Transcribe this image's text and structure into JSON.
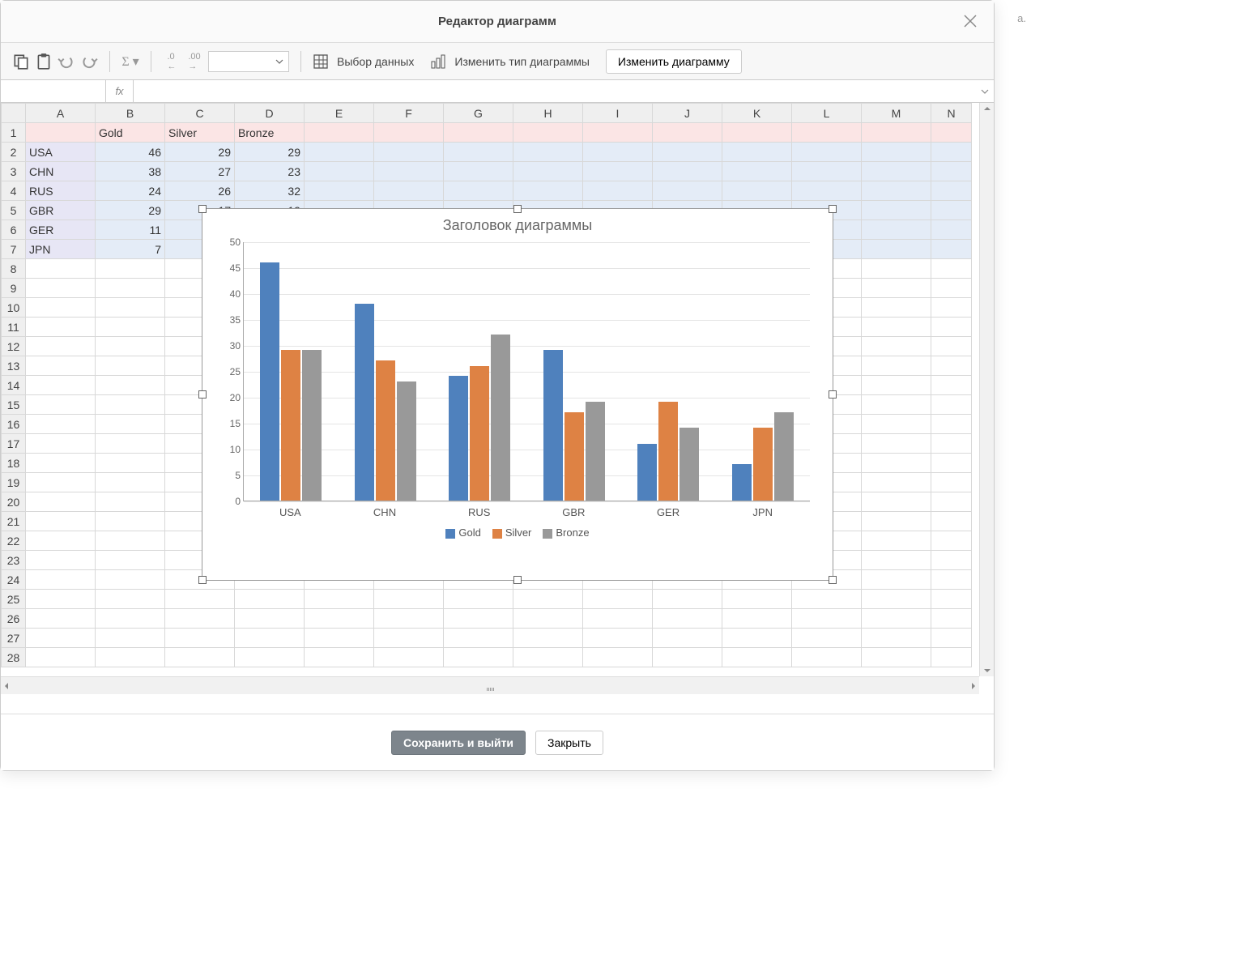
{
  "window": {
    "title": "Редактор диаграмм"
  },
  "toolbar": {
    "select_data": "Выбор данных",
    "change_type": "Изменить тип диаграммы",
    "edit_chart": "Изменить диаграмму"
  },
  "formula_bar": {
    "fx": "fx"
  },
  "columns": [
    "A",
    "B",
    "C",
    "D",
    "E",
    "F",
    "G",
    "H",
    "I",
    "J",
    "K",
    "L",
    "M",
    "N"
  ],
  "row_numbers": [
    1,
    2,
    3,
    4,
    5,
    6,
    7,
    8,
    9,
    10,
    11,
    12,
    13,
    14,
    15,
    16,
    17,
    18,
    19,
    20,
    21,
    22,
    23,
    24,
    25,
    26,
    27,
    28
  ],
  "sheet": {
    "header_row": [
      "",
      "Gold",
      "Silver",
      "Bronze"
    ],
    "data_rows": [
      [
        "USA",
        46,
        29,
        29
      ],
      [
        "CHN",
        38,
        27,
        23
      ],
      [
        "RUS",
        24,
        26,
        32
      ],
      [
        "GBR",
        29,
        17,
        19
      ],
      [
        "GER",
        11,
        "",
        ""
      ],
      [
        "JPN",
        7,
        "",
        ""
      ]
    ]
  },
  "chart_data": {
    "type": "bar",
    "title": "Заголовок диаграммы",
    "categories": [
      "USA",
      "CHN",
      "RUS",
      "GBR",
      "GER",
      "JPN"
    ],
    "series": [
      {
        "name": "Gold",
        "color": "#4f81bd",
        "values": [
          46,
          38,
          24,
          29,
          11,
          7
        ]
      },
      {
        "name": "Silver",
        "color": "#de8244",
        "values": [
          29,
          27,
          26,
          17,
          19,
          14
        ]
      },
      {
        "name": "Bronze",
        "color": "#999999",
        "values": [
          29,
          23,
          32,
          19,
          14,
          17
        ]
      }
    ],
    "ylim": [
      0,
      50
    ],
    "y_ticks": [
      0,
      5,
      10,
      15,
      20,
      25,
      30,
      35,
      40,
      45,
      50
    ],
    "xlabel": "",
    "ylabel": ""
  },
  "footer": {
    "save_exit": "Сохранить и выйти",
    "close": "Закрыть"
  },
  "overflow_hint": "a."
}
